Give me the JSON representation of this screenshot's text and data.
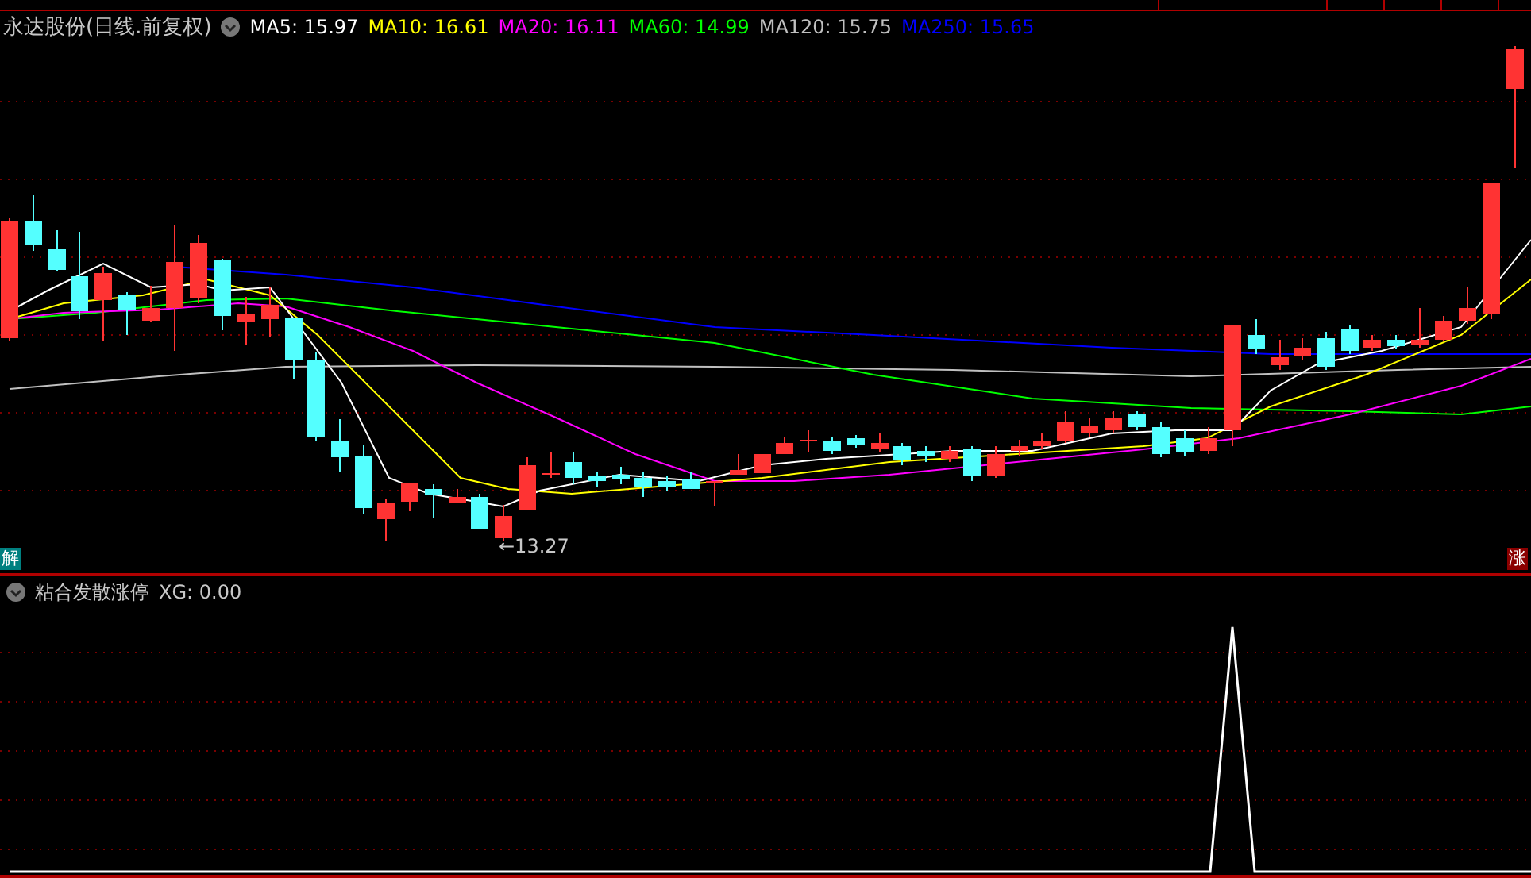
{
  "chart_header": {
    "title": "永达股份(日线.前复权)",
    "indicators": [
      {
        "label": "MA5: 15.97",
        "color": "#ffffff"
      },
      {
        "label": "MA10: 16.61",
        "color": "#ffff00"
      },
      {
        "label": "MA20: 16.11",
        "color": "#ff00ff"
      },
      {
        "label": "MA60: 14.99",
        "color": "#00ff00"
      },
      {
        "label": "MA120: 15.75",
        "color": "#c0c0c0"
      },
      {
        "label": "MA250: 15.65",
        "color": "#0000ff"
      }
    ]
  },
  "price_chart": {
    "low_marker": "←13.27",
    "left_badge": "解",
    "right_badge": "涨"
  },
  "indicator_panel": {
    "name": "粘合发散涨停",
    "value": "XG: 0.00"
  }
}
